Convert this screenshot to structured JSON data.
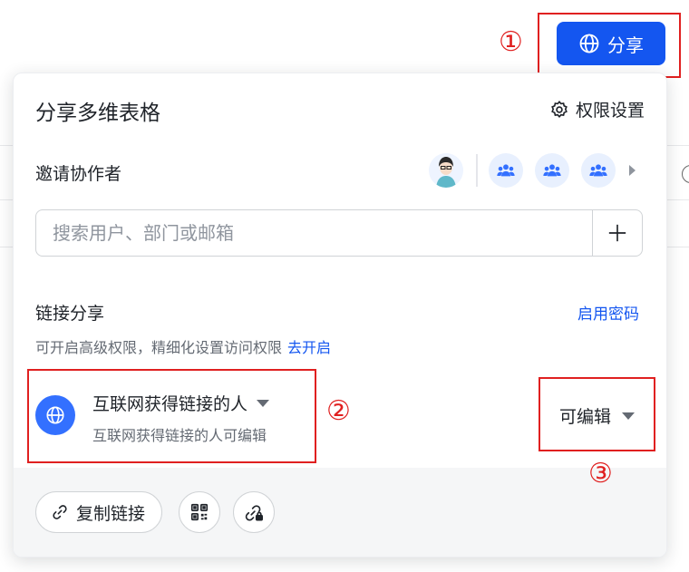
{
  "header": {
    "share_label": "分享"
  },
  "annotations": {
    "marker_1": "①",
    "marker_2": "②",
    "marker_3": "③",
    "color": "#e02020"
  },
  "popup": {
    "title": "分享多维表格",
    "permission_settings_label": "权限设置",
    "invite": {
      "label": "邀请协作者",
      "avatars": [
        "user-avatar",
        "group-avatar",
        "group-avatar",
        "group-avatar"
      ]
    },
    "search": {
      "placeholder": "搜索用户、部门或邮箱",
      "value": ""
    },
    "link_share": {
      "label": "链接分享",
      "enable_password": "启用密码",
      "hint": "可开启高级权限，精细化设置访问权限",
      "hint_link": "去开启",
      "scope_title": "互联网获得链接的人",
      "scope_desc": "互联网获得链接的人可编辑",
      "permission": "可编辑"
    },
    "footer": {
      "copy_link": "复制链接",
      "qr_icon": "qr-code-icon",
      "lock_link_icon": "link-lock-icon"
    }
  },
  "colors": {
    "primary": "#1456f0",
    "globe_bg": "#3370ff",
    "text": "#1f2329",
    "muted": "#646a73"
  }
}
